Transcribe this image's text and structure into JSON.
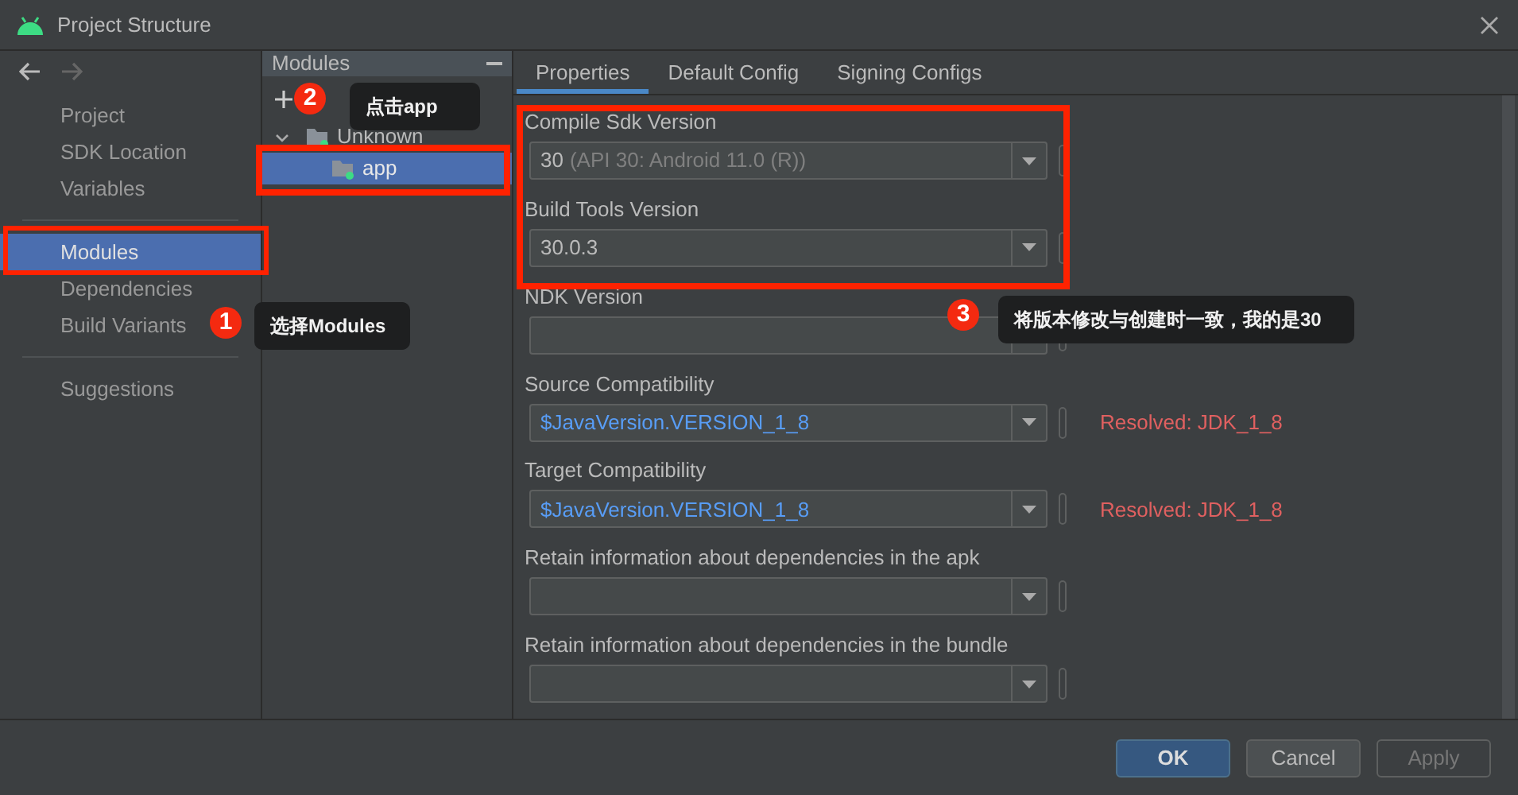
{
  "window": {
    "title": "Project Structure"
  },
  "nav": {
    "items": [
      {
        "label": "Project",
        "selected": false,
        "separator_before": false
      },
      {
        "label": "SDK Location",
        "selected": false,
        "separator_before": false
      },
      {
        "label": "Variables",
        "selected": false,
        "separator_before": false
      },
      {
        "label": "Modules",
        "selected": true,
        "separator_before": true
      },
      {
        "label": "Dependencies",
        "selected": false,
        "separator_before": false
      },
      {
        "label": "Build Variants",
        "selected": false,
        "separator_before": false
      },
      {
        "label": "Suggestions",
        "selected": false,
        "separator_before": true
      }
    ]
  },
  "modules": {
    "title": "Modules",
    "tree": [
      {
        "label": "Unknown",
        "expanded": true,
        "selected": false,
        "children": [
          {
            "label": "app",
            "selected": true
          }
        ]
      }
    ]
  },
  "tabs": [
    {
      "label": "Properties",
      "selected": true
    },
    {
      "label": "Default Config",
      "selected": false
    },
    {
      "label": "Signing Configs",
      "selected": false
    }
  ],
  "fields": [
    {
      "label": "Compile Sdk Version",
      "kind": "plain",
      "value": "30",
      "hint": "(API 30: Android 11.0 (R))"
    },
    {
      "label": "Build Tools Version",
      "kind": "plain",
      "value": "30.0.3"
    },
    {
      "label": "NDK Version"
    },
    {
      "label": "Source Compatibility",
      "kind": "expression",
      "value": "$JavaVersion.VERSION_1_8",
      "resolved": "Resolved: JDK_1_8"
    },
    {
      "label": "Target Compatibility",
      "kind": "expression",
      "value": "$JavaVersion.VERSION_1_8",
      "resolved": "Resolved: JDK_1_8"
    },
    {
      "label": "Retain information about dependencies in the apk"
    },
    {
      "label": "Retain information about dependencies in the bundle"
    }
  ],
  "buttons": [
    {
      "label": "OK",
      "kind": "default",
      "disabled": false
    },
    {
      "label": "Cancel",
      "kind": "normal",
      "disabled": false
    },
    {
      "label": "Apply",
      "kind": "normal",
      "disabled": true
    }
  ],
  "annotations": [
    {
      "number": "1",
      "text": "选择Modules"
    },
    {
      "number": "2",
      "text": "点击app"
    },
    {
      "number": "3",
      "text": "将版本修改与创建时一致，我的是30"
    }
  ]
}
